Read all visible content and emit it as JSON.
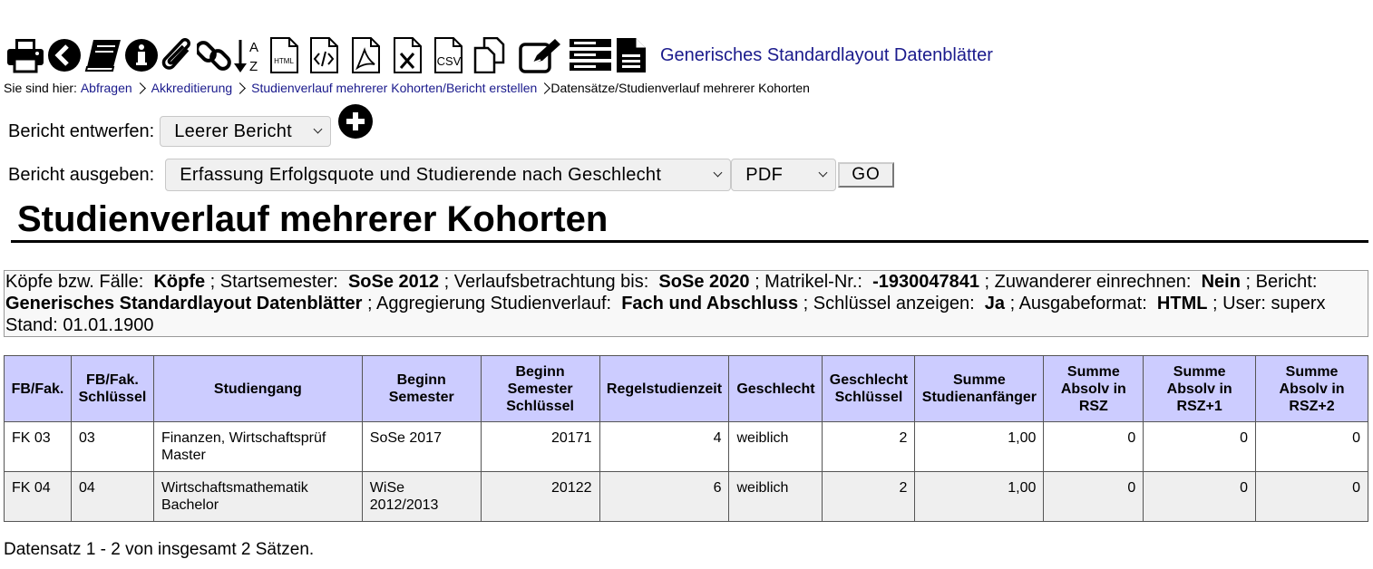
{
  "toolbar": {
    "icons": [
      "print-icon",
      "back-icon",
      "book-icon",
      "info-icon",
      "paperclip-icon",
      "link-icon",
      "sort-az-icon",
      "html-file-icon",
      "code-file-icon",
      "pdf-file-icon",
      "excel-file-icon",
      "csv-file-icon",
      "copy-icon",
      "edit-icon",
      "list-icon",
      "document-icon"
    ],
    "html_label": "HTML",
    "csv_label": "CSV",
    "sort_a": "A",
    "sort_z": "Z",
    "std_layout_link": "Generisches Standardlayout Datenblätter"
  },
  "breadcrumb": {
    "prefix": "Sie sind hier:",
    "items": [
      "Abfragen",
      "Akkreditierung",
      "Studienverlauf mehrerer Kohorten/Bericht erstellen"
    ],
    "current": "Datensätze/Studienverlauf mehrerer Kohorten"
  },
  "report_design": {
    "label": "Bericht entwerfen:",
    "selected": "Leerer Bericht"
  },
  "report_output": {
    "label": "Bericht ausgeben:",
    "selected": "Erfassung Erfolgsquote und Studierende nach Geschlecht",
    "format": "PDF",
    "go_label": "GO"
  },
  "page_title": "Studienverlauf mehrerer Kohorten",
  "params": {
    "k1": "Köpfe bzw. Fälle:",
    "v1": "Köpfe",
    "k2": "; Startsemester:",
    "v2": "SoSe 2012",
    "k3": "; Verlaufsbetrachtung bis:",
    "v3": "SoSe 2020",
    "k4": "; Matrikel-Nr.:",
    "v4": "-1930047841",
    "k5": "; Zuwanderer einrechnen:",
    "v5": "Nein",
    "k6": "; Bericht:",
    "v6": "Generisches Standardlayout Datenblätter",
    "k7": "; Aggregierung Studienverlauf:",
    "v7": "Fach und Abschluss",
    "k8": "; Schlüssel anzeigen:",
    "v8": "Ja",
    "k9": "; Ausgabeformat:",
    "v9": "HTML",
    "k10": "; User: superx",
    "stand": "Stand: 01.01.1900"
  },
  "table": {
    "headers": [
      "FB/Fak.",
      "FB/Fak. Schlüssel",
      "Studiengang",
      "Beginn Semester",
      "Beginn Semester Schlüssel",
      "Regelstudienzeit",
      "Geschlecht",
      "Geschlecht Schlüssel",
      "Summe Studienanfänger",
      "Summe Absolv in RSZ",
      "Summe Absolv in RSZ+1",
      "Summe Absolv in RSZ+2"
    ],
    "rows": [
      [
        "FK 03",
        "03",
        "Finanzen, Wirtschaftsprüf Master",
        "SoSe 2017",
        "20171",
        "4",
        "weiblich",
        "2",
        "1,00",
        "0",
        "0",
        "0"
      ],
      [
        "FK 04",
        "04",
        "Wirtschaftsmathematik Bachelor",
        "WiSe 2012/2013",
        "20122",
        "6",
        "weiblich",
        "2",
        "1,00",
        "0",
        "0",
        "0"
      ]
    ]
  },
  "footer": "Datensatz 1 - 2 von insgesamt 2 Sätzen.",
  "colors": {
    "link": "#1a1a8c",
    "header_bg": "#ccccff",
    "row_alt": "#efefef"
  }
}
